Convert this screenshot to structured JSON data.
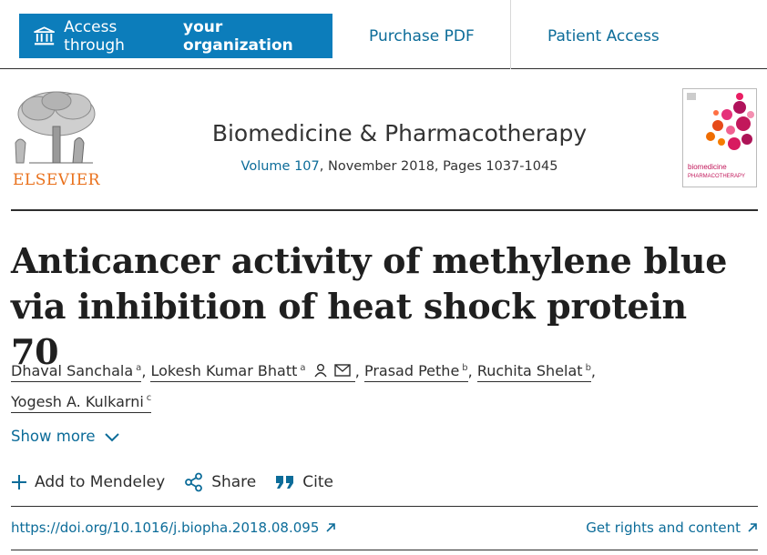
{
  "topbar": {
    "access_prefix": "Access through",
    "access_bold": "your organization",
    "purchase_pdf": "Purchase PDF",
    "patient_access": "Patient Access"
  },
  "publisher": {
    "logo_text": "ELSEVIER"
  },
  "journal": {
    "title": "Biomedicine & Pharmacotherapy",
    "volume_link": "Volume 107",
    "issue_info": ", November 2018, Pages 1037-1045",
    "cover_text_1": "biomedicine",
    "cover_text_2": "PHARMACOTHERAPY"
  },
  "article": {
    "title": "Anticancer activity of methylene blue via inhibition of heat shock protein 70"
  },
  "authors": [
    {
      "name": "Dhaval Sanchala",
      "sup": "a"
    },
    {
      "name": "Lokesh Kumar Bhatt",
      "sup": "a"
    },
    {
      "name": "Prasad Pethe",
      "sup": "b"
    },
    {
      "name": "Ruchita Shelat",
      "sup": "b"
    },
    {
      "name": "Yogesh A. Kulkarni",
      "sup": "c"
    }
  ],
  "show_more": "Show more",
  "actions": {
    "mendeley": "Add to Mendeley",
    "share": "Share",
    "cite": "Cite"
  },
  "doi": "https://doi.org/10.1016/j.biopha.2018.08.095",
  "rights": "Get rights and content",
  "colors": {
    "accent": "#0c7dbb",
    "link": "#0c6c99",
    "elsevier_orange": "#e9711c"
  }
}
